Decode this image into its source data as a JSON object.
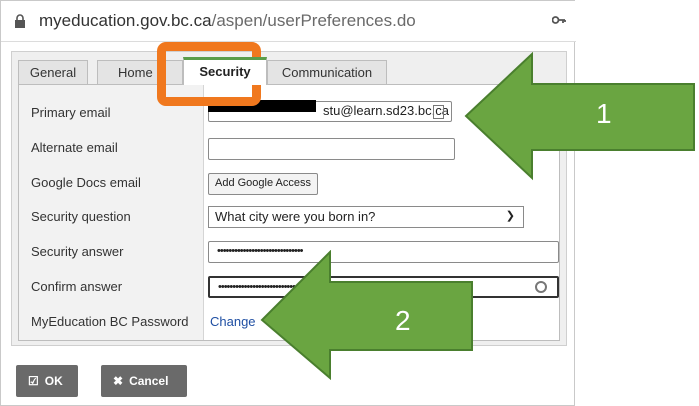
{
  "browser": {
    "url_host": "myeducation.gov.bc.ca",
    "url_path": "/aspen/userPreferences.do"
  },
  "tabs": [
    {
      "label": "General"
    },
    {
      "label": "Home"
    },
    {
      "label": "Security"
    },
    {
      "label": "Communication"
    }
  ],
  "form": {
    "primary_email_label": "Primary email",
    "primary_email_value": "stu@learn.sd23.bc.ca",
    "alternate_email_label": "Alternate email",
    "alternate_email_value": "",
    "google_docs_label": "Google Docs email",
    "google_access_button": "Add Google Access",
    "security_question_label": "Security question",
    "security_question_value": "What city were you born in?",
    "security_answer_label": "Security answer",
    "security_answer_value": "••••••••••••••••••••••••••••••",
    "confirm_answer_label": "Confirm answer",
    "confirm_answer_value": "••••••••••••••••••••••••••••",
    "password_label": "MyEducation BC Password",
    "password_link": "Change"
  },
  "buttons": {
    "ok_label": "OK",
    "cancel_label": "Cancel"
  },
  "annotations": {
    "arrow1_number": "1",
    "arrow2_number": "2",
    "arrow_color": "#6aa541",
    "highlight_color": "#f0781e"
  },
  "colors": {
    "tab_accent": "#5a9d4a",
    "link": "#1f4fa3",
    "button_bg": "#6a6a6a"
  }
}
